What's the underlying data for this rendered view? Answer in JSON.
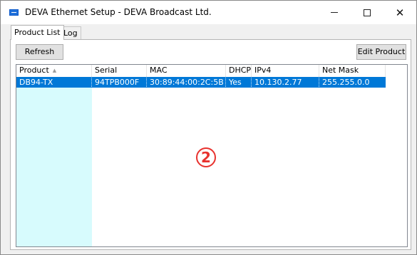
{
  "window": {
    "title": "DEVA Ethernet Setup - DEVA Broadcast Ltd.",
    "icon": "app-window-icon",
    "controls": {
      "minimize": "minimize-icon",
      "maximize": "maximize-icon",
      "close_glyph": "✕"
    }
  },
  "tabs": [
    {
      "label": "Product List",
      "active": true
    },
    {
      "label": "Log",
      "active": false
    }
  ],
  "toolbar": {
    "refresh_label": "Refresh",
    "edit_label": "Edit Product"
  },
  "table": {
    "columns": [
      {
        "label": "Product",
        "sorted": "ascending"
      },
      {
        "label": "Serial"
      },
      {
        "label": "MAC"
      },
      {
        "label": "DHCP"
      },
      {
        "label": "IPv4"
      },
      {
        "label": "Net Mask"
      }
    ],
    "sort_arrow": "▲",
    "rows": [
      {
        "selected": true,
        "cells": [
          "DB94-TX",
          "94TPB000F",
          "30:89:44:00:2C:5B",
          "Yes",
          "10.130.2.77",
          "255.255.0.0"
        ]
      }
    ]
  },
  "annotation": {
    "marker": "2",
    "color": "#e8322e"
  },
  "colors": {
    "selection": "#0078d7",
    "sorted_column": "#d7fbfd"
  }
}
